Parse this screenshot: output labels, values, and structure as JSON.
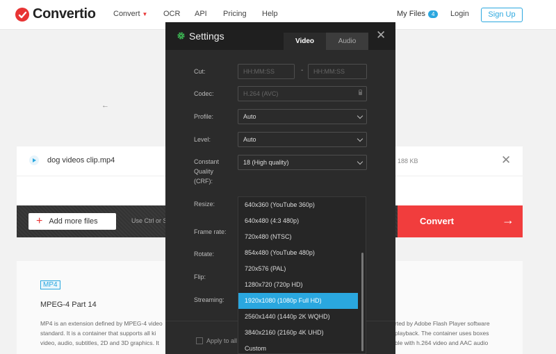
{
  "brand": {
    "name": "Convertio",
    "accent": "#e83434",
    "blue": "#2aa7df"
  },
  "nav": {
    "items": [
      {
        "label": "Convert",
        "icon": "chevron-down-icon"
      },
      {
        "label": "OCR"
      },
      {
        "label": "API"
      },
      {
        "label": "Pricing"
      },
      {
        "label": "Help"
      }
    ],
    "my_files": "My Files",
    "my_files_count": "4",
    "login": "Login",
    "signup": "Sign Up"
  },
  "file": {
    "name": "dog videos clip.mp4",
    "size": "188 KB"
  },
  "actions": {
    "add_files": "Add more files",
    "hint": "Use Ctrl or S",
    "convert": "Convert"
  },
  "settings": {
    "title": "Settings",
    "tabs": [
      "Video",
      "Audio"
    ],
    "active_tab": "Video",
    "cut": {
      "label": "Cut:",
      "start_placeholder": "HH:MM:SS",
      "end_placeholder": "HH:MM:SS",
      "separator": "-"
    },
    "codec": {
      "label": "Codec:",
      "value": "H.264 (AVC)",
      "locked": true
    },
    "profile": {
      "label": "Profile:",
      "value": "Auto"
    },
    "level": {
      "label": "Level:",
      "value": "Auto"
    },
    "crf": {
      "label_lines": [
        "Constant",
        "Quality",
        "(CRF):"
      ],
      "value": "18 (High quality)"
    },
    "resize": {
      "label": "Resize:"
    },
    "frame_rate": {
      "label": "Frame rate:"
    },
    "rotate": {
      "label": "Rotate:"
    },
    "flip": {
      "label": "Flip:"
    },
    "streaming": {
      "label": "Streaming:"
    },
    "resize_options": [
      "640x360 (YouTube 360p)",
      "640x480 (4:3 480p)",
      "720x480 (NTSC)",
      "854x480 (YouTube 480p)",
      "720x576 (PAL)",
      "1280x720 (720p HD)",
      "1920x1080 (1080p Full HD)",
      "2560x1440 (1440p 2K WQHD)",
      "3840x2160 (2160p 4K UHD)",
      "Custom"
    ],
    "selected_resize": "1920x1080 (1080p Full HD)",
    "apply_all": "Apply to all"
  },
  "format_info": {
    "tag": "MP4",
    "title": "MPEG-4 Part 14",
    "desc_left": [
      "MP4 is an extension defined by MPEG-4 video",
      "standard. It is a container that supports all ki",
      "video, audio, subtitles, 2D and 3D graphics. It"
    ],
    "desc_right": [
      "rted by Adobe Flash Player software",
      "playback. The container uses boxes",
      "ble with h.264 video and AAC audio"
    ]
  }
}
